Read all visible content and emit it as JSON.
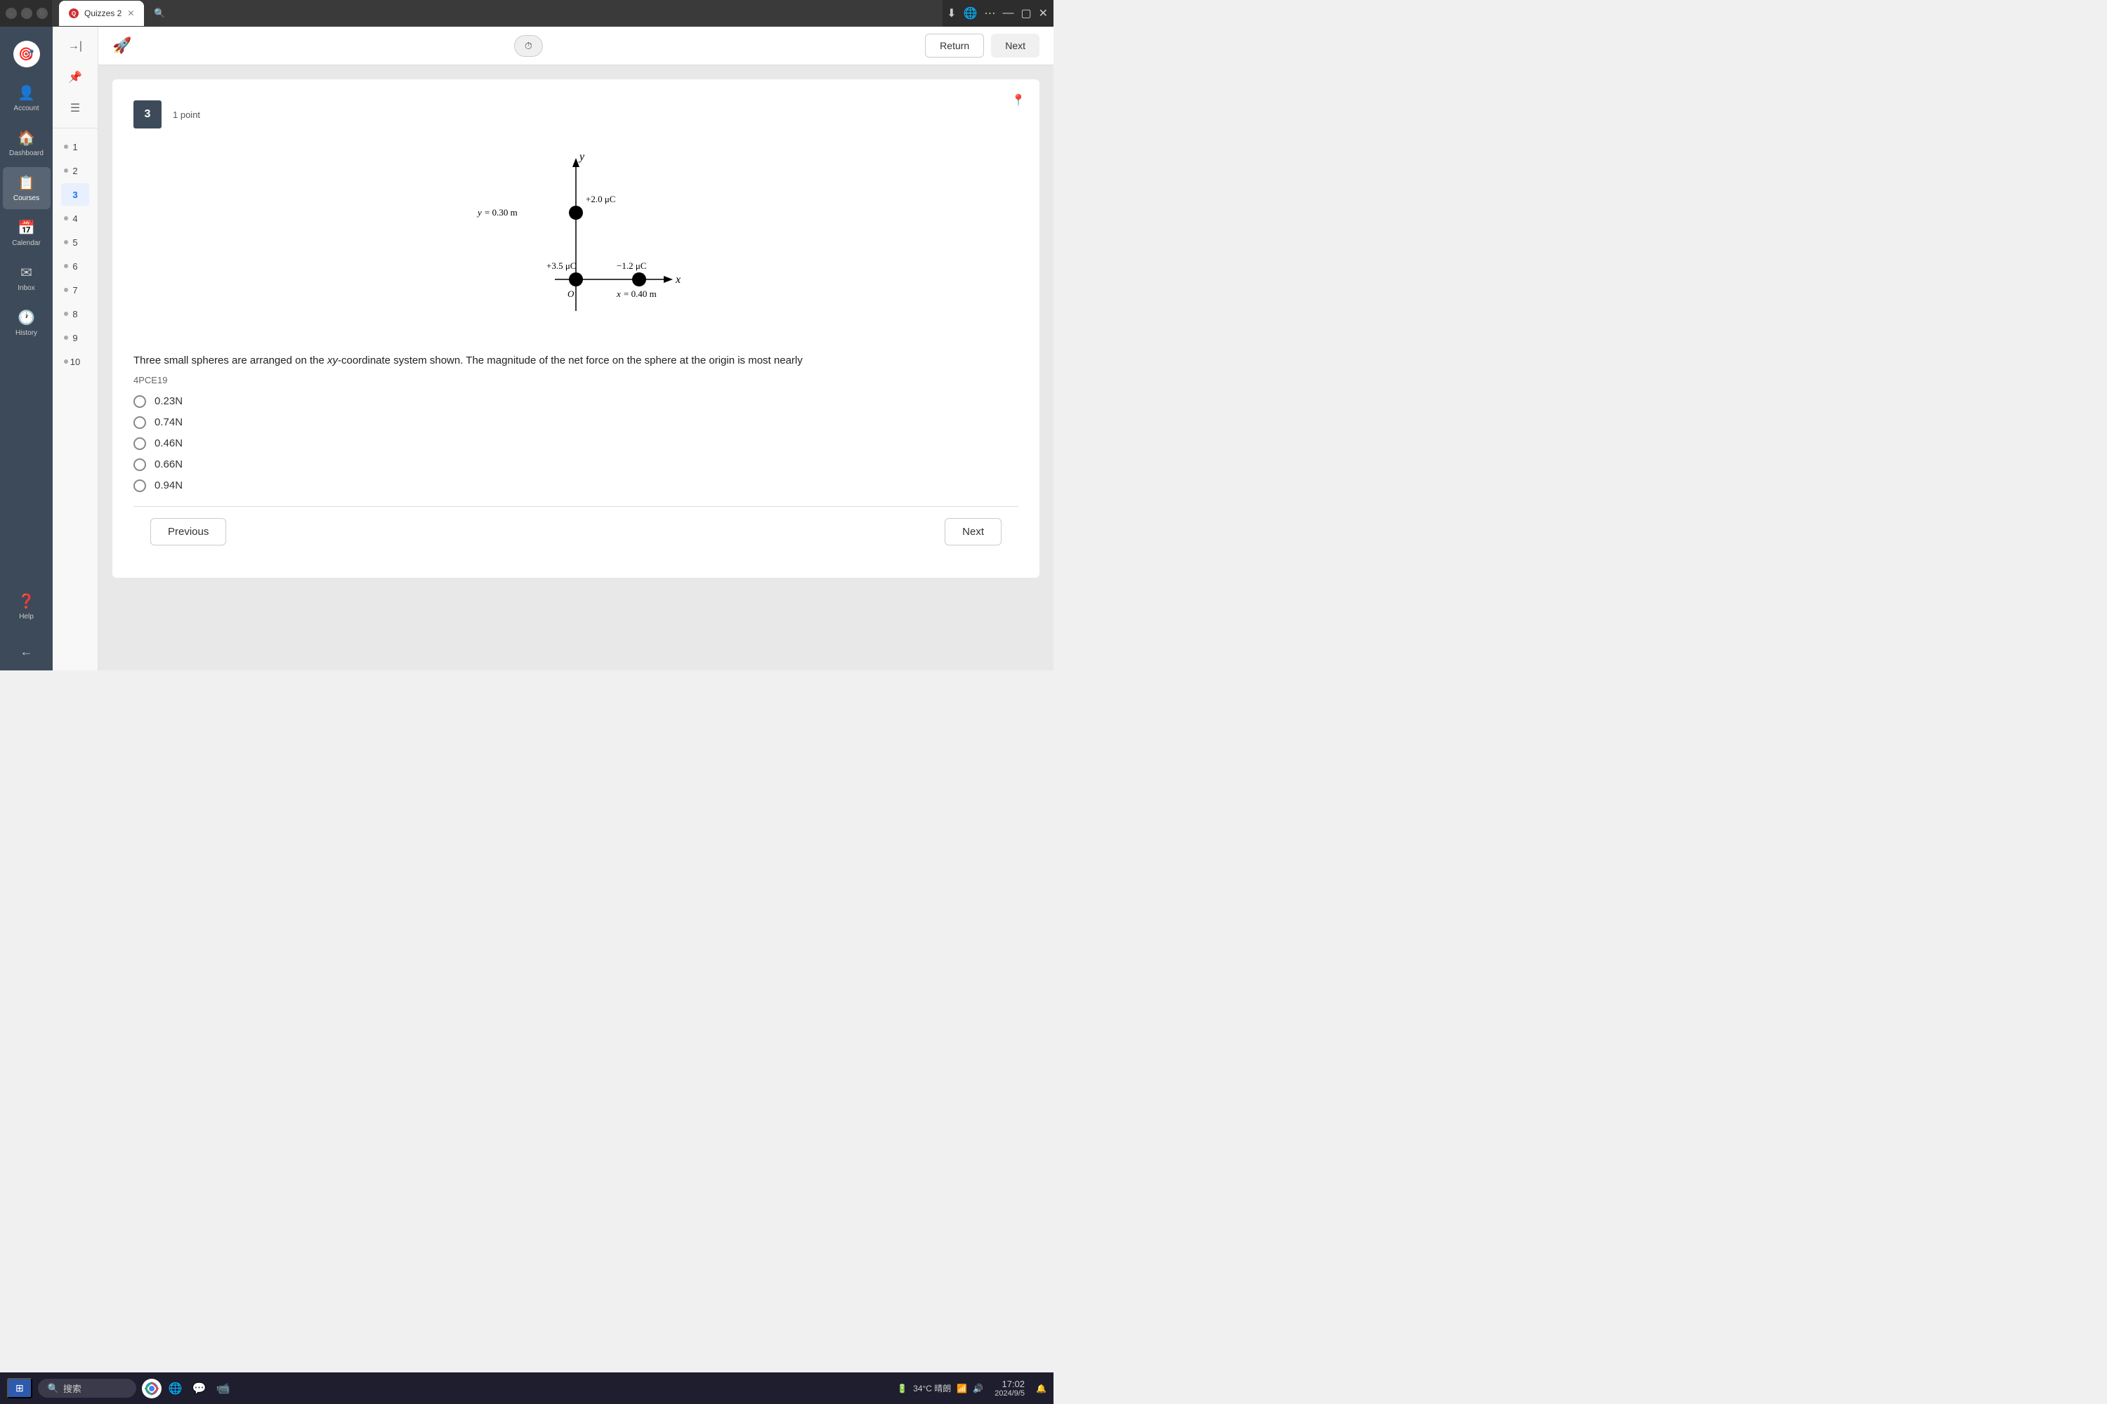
{
  "browser": {
    "tab_title": "Quizzes 2",
    "search_icon": "🔍",
    "back_icon": "←",
    "forward_icon": "→",
    "refresh_icon": "↺",
    "more_icon": "⋯",
    "minimize_icon": "—",
    "maximize_icon": "▢",
    "close_icon": "✕"
  },
  "toolbar": {
    "timer_label": "⏱",
    "return_label": "Return",
    "next_label": "Next"
  },
  "sidebar": {
    "items": [
      {
        "id": "account",
        "label": "Account",
        "icon": "👤"
      },
      {
        "id": "dashboard",
        "label": "Dashboard",
        "icon": "📊"
      },
      {
        "id": "courses",
        "label": "Courses",
        "icon": "📚"
      },
      {
        "id": "calendar",
        "label": "Calendar",
        "icon": "📅"
      },
      {
        "id": "inbox",
        "label": "Inbox",
        "icon": "✉"
      },
      {
        "id": "history",
        "label": "History",
        "icon": "🕐"
      },
      {
        "id": "help",
        "label": "Help",
        "icon": "❓"
      }
    ],
    "collapse_icon": "←"
  },
  "question_nav": {
    "numbers": [
      1,
      2,
      3,
      4,
      5,
      6,
      7,
      8,
      9,
      10
    ],
    "active": 3
  },
  "question": {
    "number": "3",
    "points": "1 point",
    "id": "4PCE19",
    "text": "Three small spheres are arranged on the xy-coordinate system shown. The magnitude of the net force on the sphere at the origin is most nearly",
    "choices": [
      {
        "id": "a",
        "value": "0.23N"
      },
      {
        "id": "b",
        "value": "0.74N"
      },
      {
        "id": "c",
        "value": "0.46N"
      },
      {
        "id": "d",
        "value": "0.66N"
      },
      {
        "id": "e",
        "value": "0.94N"
      }
    ]
  },
  "navigation": {
    "previous_label": "Previous",
    "next_label": "Next"
  },
  "taskbar": {
    "search_placeholder": "搜索",
    "time": "17:02",
    "date": "2024/9/5",
    "weather": "34°C 晴朗"
  }
}
